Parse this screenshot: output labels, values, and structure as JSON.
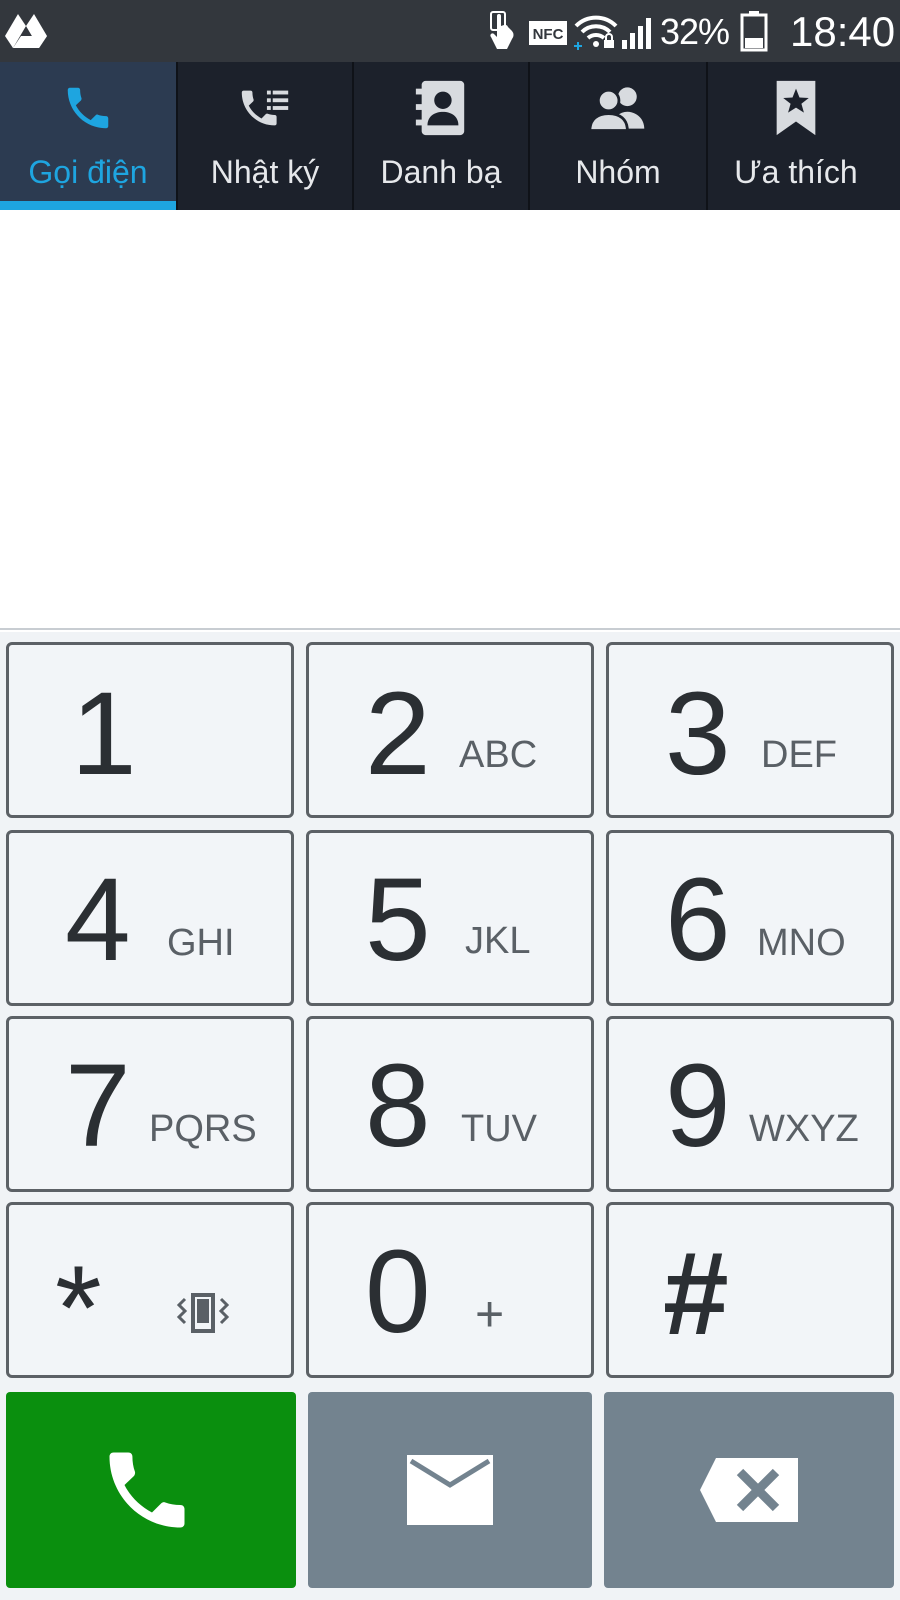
{
  "status_bar": {
    "nfc_label": "NFC",
    "battery_percent": "32%",
    "battery_level": 0.32,
    "time": "18:40",
    "icons": [
      "google-drive-icon",
      "touch-icon",
      "nfc-icon",
      "wifi-icon",
      "signal-icon",
      "battery-icon"
    ]
  },
  "tabs": [
    {
      "label": "Gọi điện",
      "icon": "phone-icon",
      "active": true
    },
    {
      "label": "Nhật ký",
      "icon": "call-log-icon",
      "active": false
    },
    {
      "label": "Danh bạ",
      "icon": "contacts-icon",
      "active": false
    },
    {
      "label": "Nhóm",
      "icon": "groups-icon",
      "active": false
    },
    {
      "label": "Ưa thích",
      "icon": "favorites-icon",
      "active": false
    }
  ],
  "keypad": {
    "keys": [
      {
        "digit": "1",
        "letters": ""
      },
      {
        "digit": "2",
        "letters": "ABC"
      },
      {
        "digit": "3",
        "letters": "DEF"
      },
      {
        "digit": "4",
        "letters": "GHI"
      },
      {
        "digit": "5",
        "letters": "JKL"
      },
      {
        "digit": "6",
        "letters": "MNO"
      },
      {
        "digit": "7",
        "letters": "PQRS"
      },
      {
        "digit": "8",
        "letters": "TUV"
      },
      {
        "digit": "9",
        "letters": "WXYZ"
      },
      {
        "digit": "*",
        "letters": "",
        "sub_icon": "vibrate-icon"
      },
      {
        "digit": "0",
        "letters": "+"
      },
      {
        "digit": "#",
        "letters": ""
      }
    ]
  },
  "actions": {
    "call": {
      "icon": "phone-icon",
      "color": "#0a8f0e"
    },
    "message": {
      "icon": "envelope-icon",
      "color": "#73838f"
    },
    "delete": {
      "icon": "backspace-icon",
      "color": "#73838f"
    }
  },
  "colors": {
    "accent": "#1ea5e0",
    "status_bar_bg": "#33373d",
    "tab_bar_bg": "#1c212b",
    "active_tab_bg": "#2c3b51"
  }
}
